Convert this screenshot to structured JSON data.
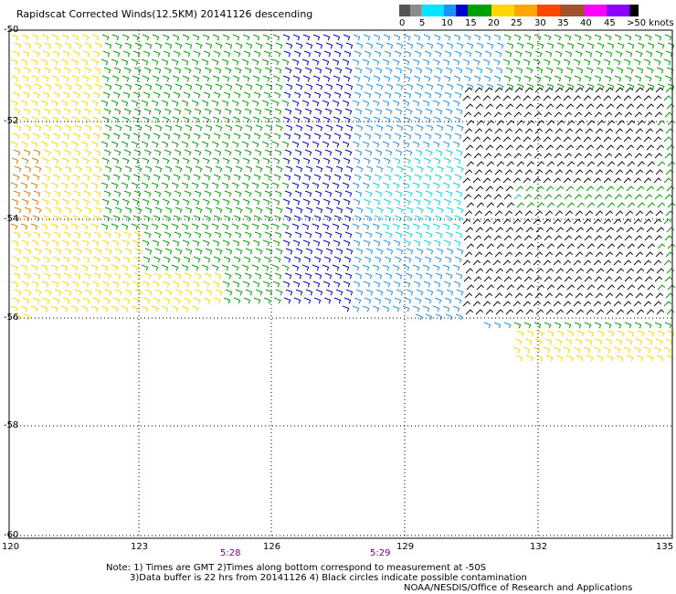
{
  "title": "Rapidscat Corrected Winds(12.5KM) 20141126 descending",
  "legend": {
    "labels": [
      "0",
      "5",
      "10",
      "15",
      "20",
      "25",
      "30",
      "35",
      "40",
      "45",
      ">50 knots"
    ],
    "colors": [
      "#555555",
      "#8c8c8c",
      "#00e5ff",
      "#1e90ff",
      "#0000cc",
      "#00a000",
      "#ffd700",
      "#ffa500",
      "#ff4500",
      "#a0522d",
      "#ff00ff",
      "#8b00ff",
      "#000000"
    ]
  },
  "map": {
    "lat_labels": [
      "-50",
      "-52",
      "-54",
      "-56",
      "-58",
      "-60"
    ],
    "lon_labels": [
      "120",
      "123",
      "126",
      "129",
      "132",
      "135"
    ],
    "time_labels": [
      "5:28",
      "5:29"
    ]
  },
  "notes": {
    "line1": "Note: 1) Times are GMT 2)Times along bottom correspond to measurement at -50S",
    "line2": "3)Data buffer is 22 hrs from 20141126 4) Black circles indicate possible contamination",
    "credit": "NOAA/NESDIS/Office of Research and Applications"
  }
}
